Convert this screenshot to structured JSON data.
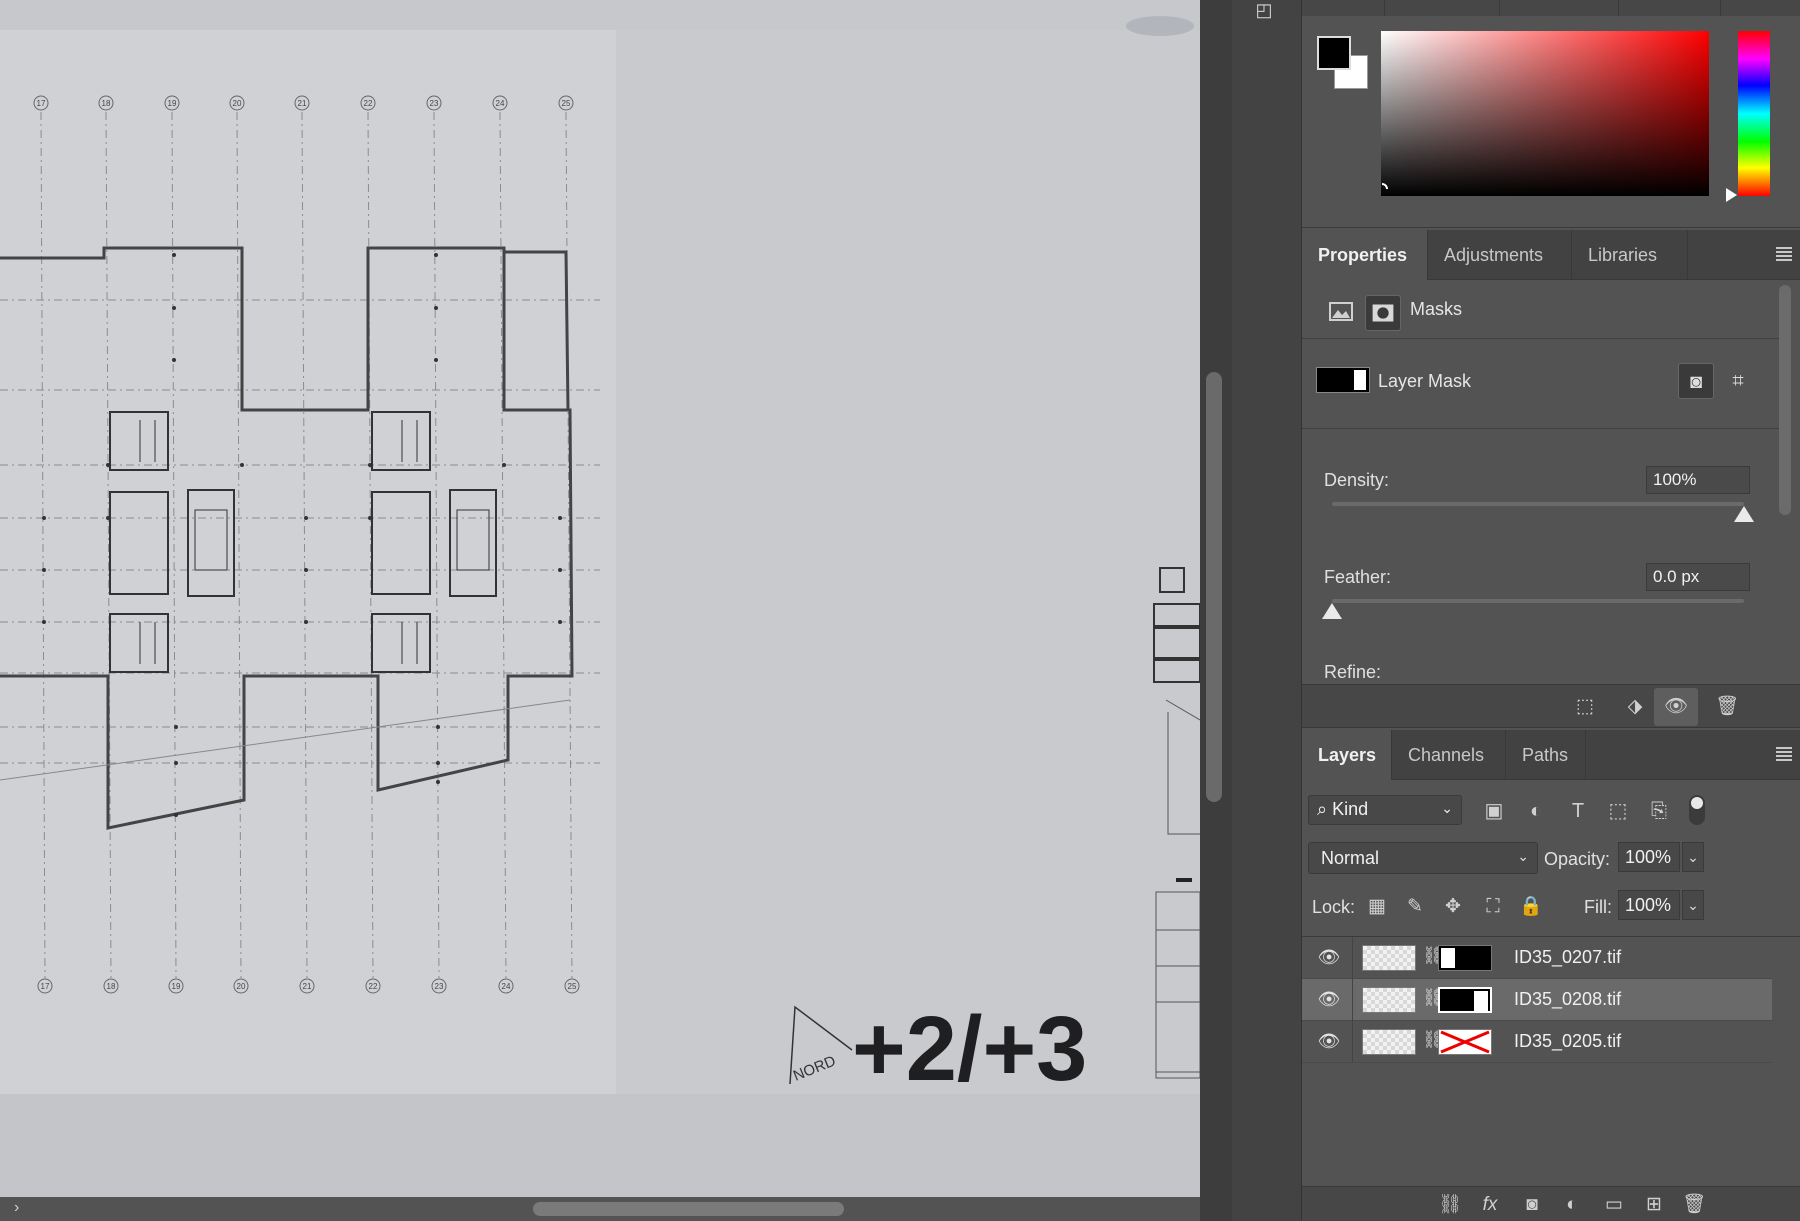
{
  "canvas": {
    "grid_top": [
      "17",
      "18",
      "19",
      "20",
      "21",
      "22",
      "23",
      "24",
      "25"
    ],
    "grid_bottom": [
      "17",
      "18",
      "19",
      "20",
      "21",
      "22",
      "23",
      "24",
      "25"
    ],
    "north_label": "NORD",
    "floor_label": "+2/+3"
  },
  "color_panel": {
    "foreground": "#000000",
    "background": "#ffffff"
  },
  "properties": {
    "tabs": [
      "Properties",
      "Adjustments",
      "Libraries"
    ],
    "active_tab": "Properties",
    "section_label": "Masks",
    "mask_label": "Layer Mask",
    "density_label": "Density:",
    "density_value": "100%",
    "density_level": 1.0,
    "feather_label": "Feather:",
    "feather_value": "0.0 px",
    "feather_level": 0.0,
    "refine_label": "Refine:"
  },
  "layers": {
    "tabs": [
      "Layers",
      "Channels",
      "Paths"
    ],
    "active_tab": "Layers",
    "filter_kind": "Kind",
    "blend_mode": "Normal",
    "opacity_label": "Opacity:",
    "opacity_value": "100%",
    "lock_label": "Lock:",
    "fill_label": "Fill:",
    "fill_value": "100%",
    "items": [
      {
        "name": "ID35_0207.tif",
        "selected": false,
        "mask_disabled": false
      },
      {
        "name": "ID35_0208.tif",
        "selected": true,
        "mask_disabled": false
      },
      {
        "name": "ID35_0205.tif",
        "selected": false,
        "mask_disabled": true
      }
    ]
  }
}
